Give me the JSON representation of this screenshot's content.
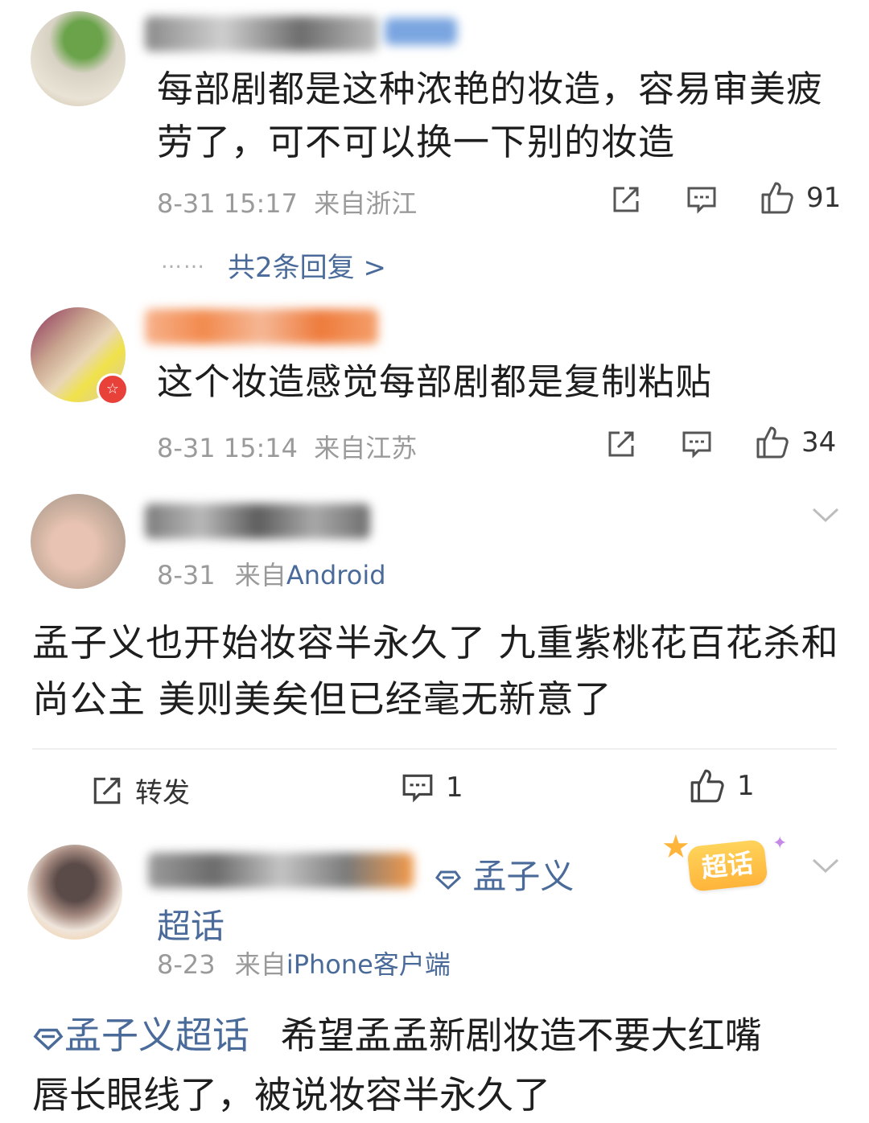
{
  "comments": [
    {
      "text": "每部剧都是这种浓艳的妆造，容易审美疲劳了，可不可以换一下别的妆造",
      "date": "8-31 15:17",
      "location": "来自浙江",
      "likes": "91",
      "replies_link": "共2条回复 >",
      "replies_dots": "……"
    },
    {
      "text": "这个妆造感觉每部剧都是复制粘贴",
      "date": "8-31 15:14",
      "location": "来自江苏",
      "likes": "34"
    }
  ],
  "post1": {
    "date": "8-31",
    "from_label": "来自",
    "source": "Android",
    "text": "孟子义也开始妆容半永久了 九重紫桃花百花杀和尚公主 美则美矣但已经毫无新意了",
    "repost_label": "转发",
    "comment_count": "1",
    "like_count": "1"
  },
  "post2": {
    "topic_name": "孟子义",
    "topic_name_2": "超话",
    "super_topic_badge": "超话",
    "date": "8-23",
    "from_label": "来自",
    "source": "iPhone客户端",
    "topic_tag": "孟子义超话",
    "text_line1": "希望孟孟新剧妆造不要大红嘴",
    "text_line2": "唇长眼线了，被说妆容半永久了"
  },
  "icons": [
    "share-icon",
    "comment-icon",
    "like-icon",
    "chevron-down-icon",
    "diamond-icon"
  ],
  "colors": {
    "link": "#4a6b9a",
    "meta": "#9a9a9a",
    "text": "#1e1e1e"
  }
}
